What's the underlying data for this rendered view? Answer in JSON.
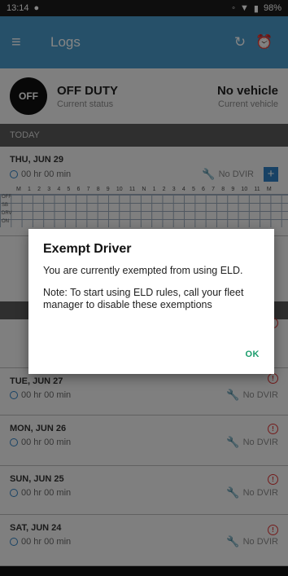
{
  "statusbar": {
    "time": "13:14",
    "battery": "98%"
  },
  "appbar": {
    "title": "Logs"
  },
  "status": {
    "badge": "OFF",
    "duty": "OFF DUTY",
    "duty_sub": "Current status",
    "vehicle": "No vehicle",
    "vehicle_sub": "Current vehicle"
  },
  "sections": {
    "today": "TODAY"
  },
  "today_card": {
    "date": "THU, JUN 29",
    "hours": "00 hr 00 min",
    "dvir": "No DVIR",
    "grid_hours": [
      "M",
      "1",
      "2",
      "3",
      "4",
      "5",
      "6",
      "7",
      "8",
      "9",
      "10",
      "11",
      "N",
      "1",
      "2",
      "3",
      "4",
      "5",
      "6",
      "7",
      "8",
      "9",
      "10",
      "11",
      "M"
    ],
    "row_labels": [
      "OFF",
      "SB",
      "DRV",
      "ON"
    ]
  },
  "days": [
    {
      "date": "TUE, JUN 27",
      "hours": "00 hr 00 min",
      "dvir": "No DVIR"
    },
    {
      "date": "MON, JUN 26",
      "hours": "00 hr 00 min",
      "dvir": "No DVIR"
    },
    {
      "date": "SUN, JUN 25",
      "hours": "00 hr 00 min",
      "dvir": "No DVIR"
    },
    {
      "date": "SAT, JUN 24",
      "hours": "00 hr 00 min",
      "dvir": "No DVIR"
    }
  ],
  "dialog": {
    "title": "Exempt Driver",
    "body1": "You are currently exempted from using ELD.",
    "body2": "Note: To start using ELD rules, call your fleet manager to disable these exemptions",
    "ok": "OK"
  }
}
